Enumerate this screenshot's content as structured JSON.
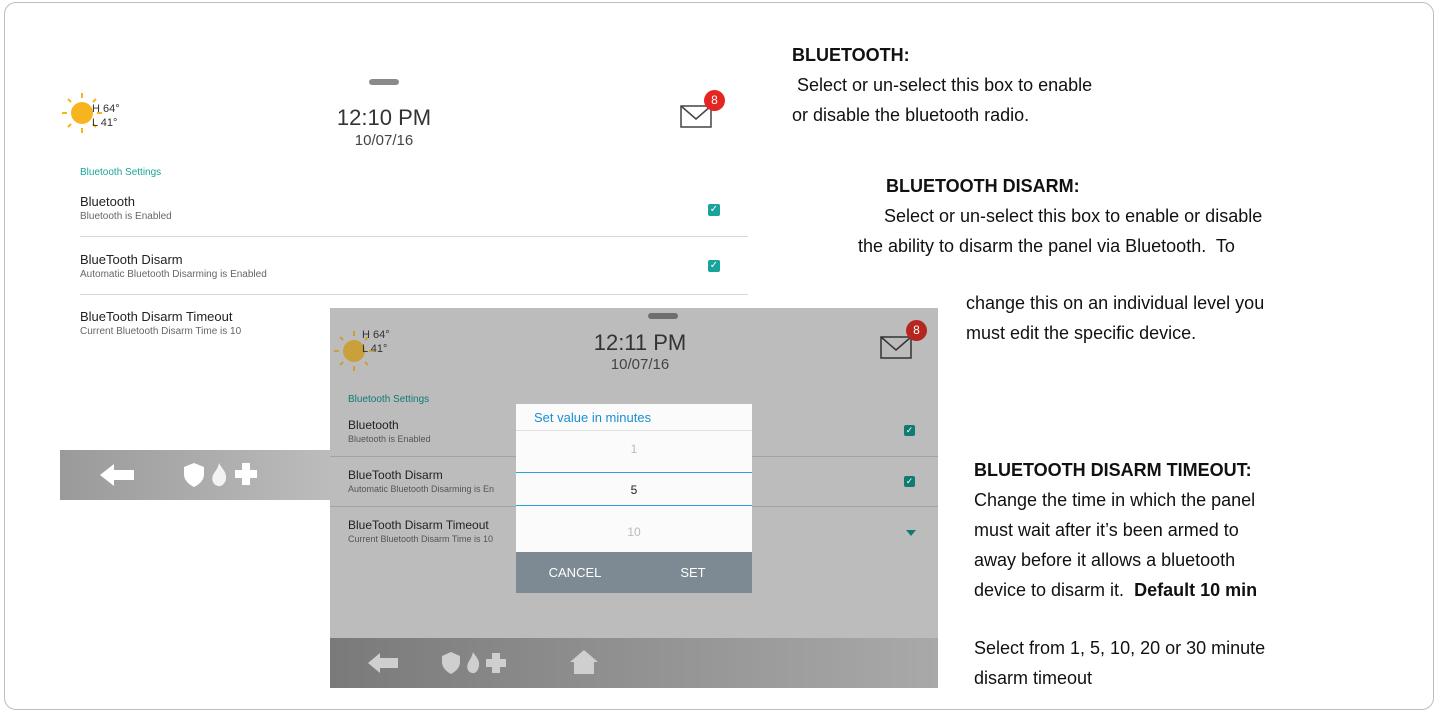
{
  "panel1": {
    "weather_high": "H 64°",
    "weather_low": "L 41°",
    "time": "12:10 PM",
    "date": "10/07/16",
    "badge_count": "8",
    "section_title": "Bluetooth Settings",
    "rows": [
      {
        "title": "Bluetooth",
        "subtitle": "Bluetooth is Enabled",
        "checked": true
      },
      {
        "title": "BlueTooth Disarm",
        "subtitle": "Automatic Bluetooth Disarming is Enabled",
        "checked": true
      },
      {
        "title": "BlueTooth Disarm Timeout",
        "subtitle": "Current Bluetooth Disarm Time is 10"
      }
    ]
  },
  "panel2": {
    "weather_high": "H 64°",
    "weather_low": "L 41°",
    "time": "12:11 PM",
    "date": "10/07/16",
    "badge_count": "8",
    "section_title": "Bluetooth Settings",
    "rows": [
      {
        "title": "Bluetooth",
        "subtitle": "Bluetooth is Enabled"
      },
      {
        "title": "BlueTooth Disarm",
        "subtitle": "Automatic Bluetooth Disarming is En"
      },
      {
        "title": "BlueTooth Disarm Timeout",
        "subtitle": "Current Bluetooth Disarm Time is 10"
      }
    ],
    "dialog": {
      "title": "Set value in minutes",
      "values": [
        "1",
        "5",
        "10"
      ],
      "selected": "5",
      "cancel": "CANCEL",
      "set": "SET"
    }
  },
  "annotations": {
    "bluetooth_heading": "BLUETOOTH:",
    "bluetooth_line1": " Select or un-select this box to enable",
    "bluetooth_line2": "or disable the bluetooth radio.",
    "disarm_heading": "BLUETOOTH DISARM:",
    "disarm_line1": "Select or un-select this box to enable or disable",
    "disarm_line2": "the ability to disarm the panel via Bluetooth.  To",
    "disarm_line3": "change this on an individual level you",
    "disarm_line4": "must edit the specific device.",
    "timeout_heading": "BLUETOOTH DISARM TIMEOUT:",
    "timeout_line1": "Change the time in which the panel",
    "timeout_line2": "must wait after it’s been armed to",
    "timeout_line3": "away before it allows a bluetooth",
    "timeout_line4": "device to disarm it.",
    "timeout_default": "Default 10 min",
    "select_line1": "Select from 1, 5, 10, 20 or 30 minute",
    "select_line2": "disarm timeout"
  },
  "colors": {
    "accent": "#1aa39a",
    "badge": "#e52521",
    "dialog_accent": "#1a8fd0"
  }
}
